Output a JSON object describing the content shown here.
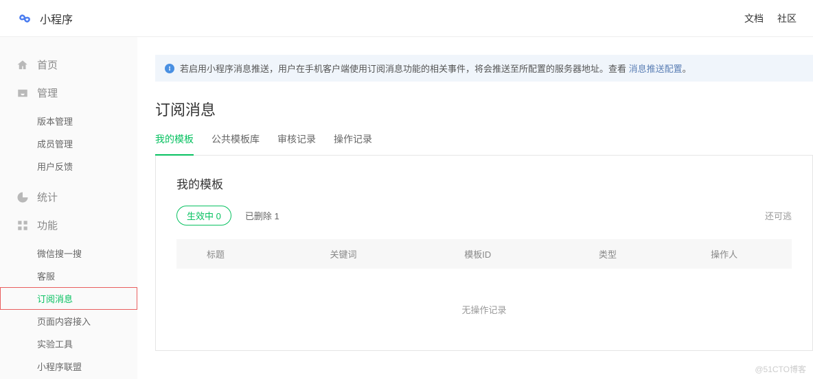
{
  "header": {
    "brand": "小程序",
    "links": [
      "文档",
      "社区"
    ]
  },
  "sidebar": {
    "home": "首页",
    "manage": {
      "label": "管理",
      "items": [
        "版本管理",
        "成员管理",
        "用户反馈"
      ]
    },
    "stats": "统计",
    "features": {
      "label": "功能",
      "items": [
        "微信搜一搜",
        "客服",
        "订阅消息",
        "页面内容接入",
        "实验工具",
        "小程序联盟"
      ]
    }
  },
  "banner": {
    "text": "若启用小程序消息推送，用户在手机客户端使用订阅消息功能的相关事件，将会推送至所配置的服务器地址。查看 ",
    "link": "消息推送配置",
    "suffix": "。"
  },
  "page": {
    "title": "订阅消息",
    "tabs": [
      "我的模板",
      "公共模板库",
      "审核记录",
      "操作记录"
    ],
    "panel_title": "我的模板",
    "filters": {
      "active_label": "生效中",
      "active_count": "0",
      "deleted_label": "已删除",
      "deleted_count": "1",
      "right_text": "还可逃"
    },
    "columns": {
      "title": "标题",
      "keyword": "关键词",
      "template_id": "模板ID",
      "type": "类型",
      "operator": "操作人"
    },
    "empty_text": "无操作记录"
  },
  "watermark": "@51CTO博客"
}
